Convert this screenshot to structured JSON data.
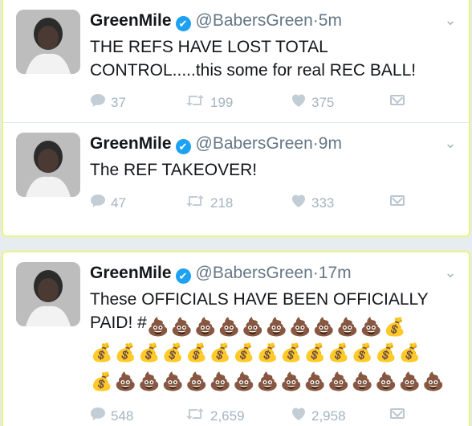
{
  "tweets": [
    {
      "name": "GreenMile",
      "handle": "@BabersGreen",
      "dot": "·",
      "time": "5m",
      "text": "THE REFS HAVE LOST TOTAL\nCONTROL.....this some for real REC BALL!",
      "replies": "37",
      "retweets": "199",
      "likes": "375"
    },
    {
      "name": "GreenMile",
      "handle": "@BabersGreen",
      "dot": "·",
      "time": "9m",
      "text": "The REF TAKEOVER!",
      "replies": "47",
      "retweets": "218",
      "likes": "333"
    },
    {
      "name": "GreenMile",
      "handle": "@BabersGreen",
      "dot": "·",
      "time": "17m",
      "text": "These OFFICIALS HAVE BEEN OFFICIALLY\nPAID! #",
      "replies": "548",
      "retweets": "2,659",
      "likes": "2,958"
    }
  ],
  "icons": {
    "verified": "✔",
    "chevron": "⌄",
    "reply": "💬",
    "retweet": "⇄",
    "like": "♥",
    "poop": "💩",
    "money_bag": "💰"
  }
}
